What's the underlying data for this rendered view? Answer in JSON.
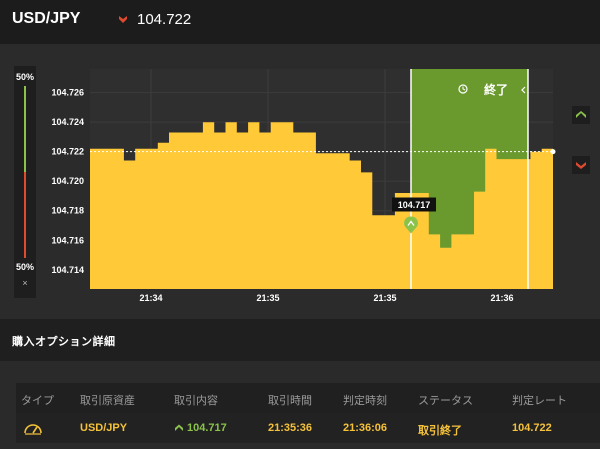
{
  "header": {
    "pair": "USD/JPY",
    "rate": "104.722",
    "direction_icon": "down-arrow-icon"
  },
  "gauge": {
    "top_label": "50%",
    "bottom_label": "50%",
    "close_label": "×"
  },
  "chart_data": {
    "type": "area",
    "y_ticks": [
      "104.726",
      "104.724",
      "104.722",
      "104.720",
      "104.718",
      "104.716",
      "104.714"
    ],
    "x_ticks": [
      "21:34",
      "21:35",
      "21:35",
      "21:36"
    ],
    "series": [
      {
        "values": [
          104.7222,
          104.7222,
          104.7222,
          104.7214,
          104.7222,
          104.7222,
          104.7226,
          104.7233,
          104.7233,
          104.7233,
          104.724,
          104.7233,
          104.724,
          104.7233,
          104.724,
          104.7233,
          104.724,
          104.724,
          104.7233,
          104.7233,
          104.7219,
          104.7219,
          104.7219,
          104.7214,
          104.7206,
          104.7177,
          104.7177,
          104.7192,
          104.7192,
          104.7192,
          104.7164,
          104.7155,
          104.7164,
          104.7164,
          104.7193,
          104.7222,
          104.7215,
          104.7215,
          104.7215,
          104.722,
          104.7222
        ]
      }
    ],
    "current_rate": 104.722,
    "entry_rate": 104.717,
    "entry_label": "104.717",
    "period_label": "終了",
    "ylim": [
      104.7127,
      104.7276
    ],
    "grid": true
  },
  "section": {
    "title": "購入オプション詳細"
  },
  "table": {
    "headers": [
      "タイプ",
      "取引原資産",
      "取引内容",
      "取引時間",
      "判定時刻",
      "ステータス",
      "判定レート"
    ],
    "row": {
      "type_icon": "gauge-icon",
      "asset": "USD/JPY",
      "content_icon": "up-arrow-icon",
      "content": "104.717",
      "trade_time": "21:35:36",
      "judge_time": "21:36:06",
      "status": "取引終了",
      "judge_rate": "104.722"
    }
  },
  "colors": {
    "area": "#ffc937",
    "period": "#6a9a2e",
    "up": "#8bc34a",
    "down": "#e04a2f",
    "text_value": "#f5c23a"
  }
}
